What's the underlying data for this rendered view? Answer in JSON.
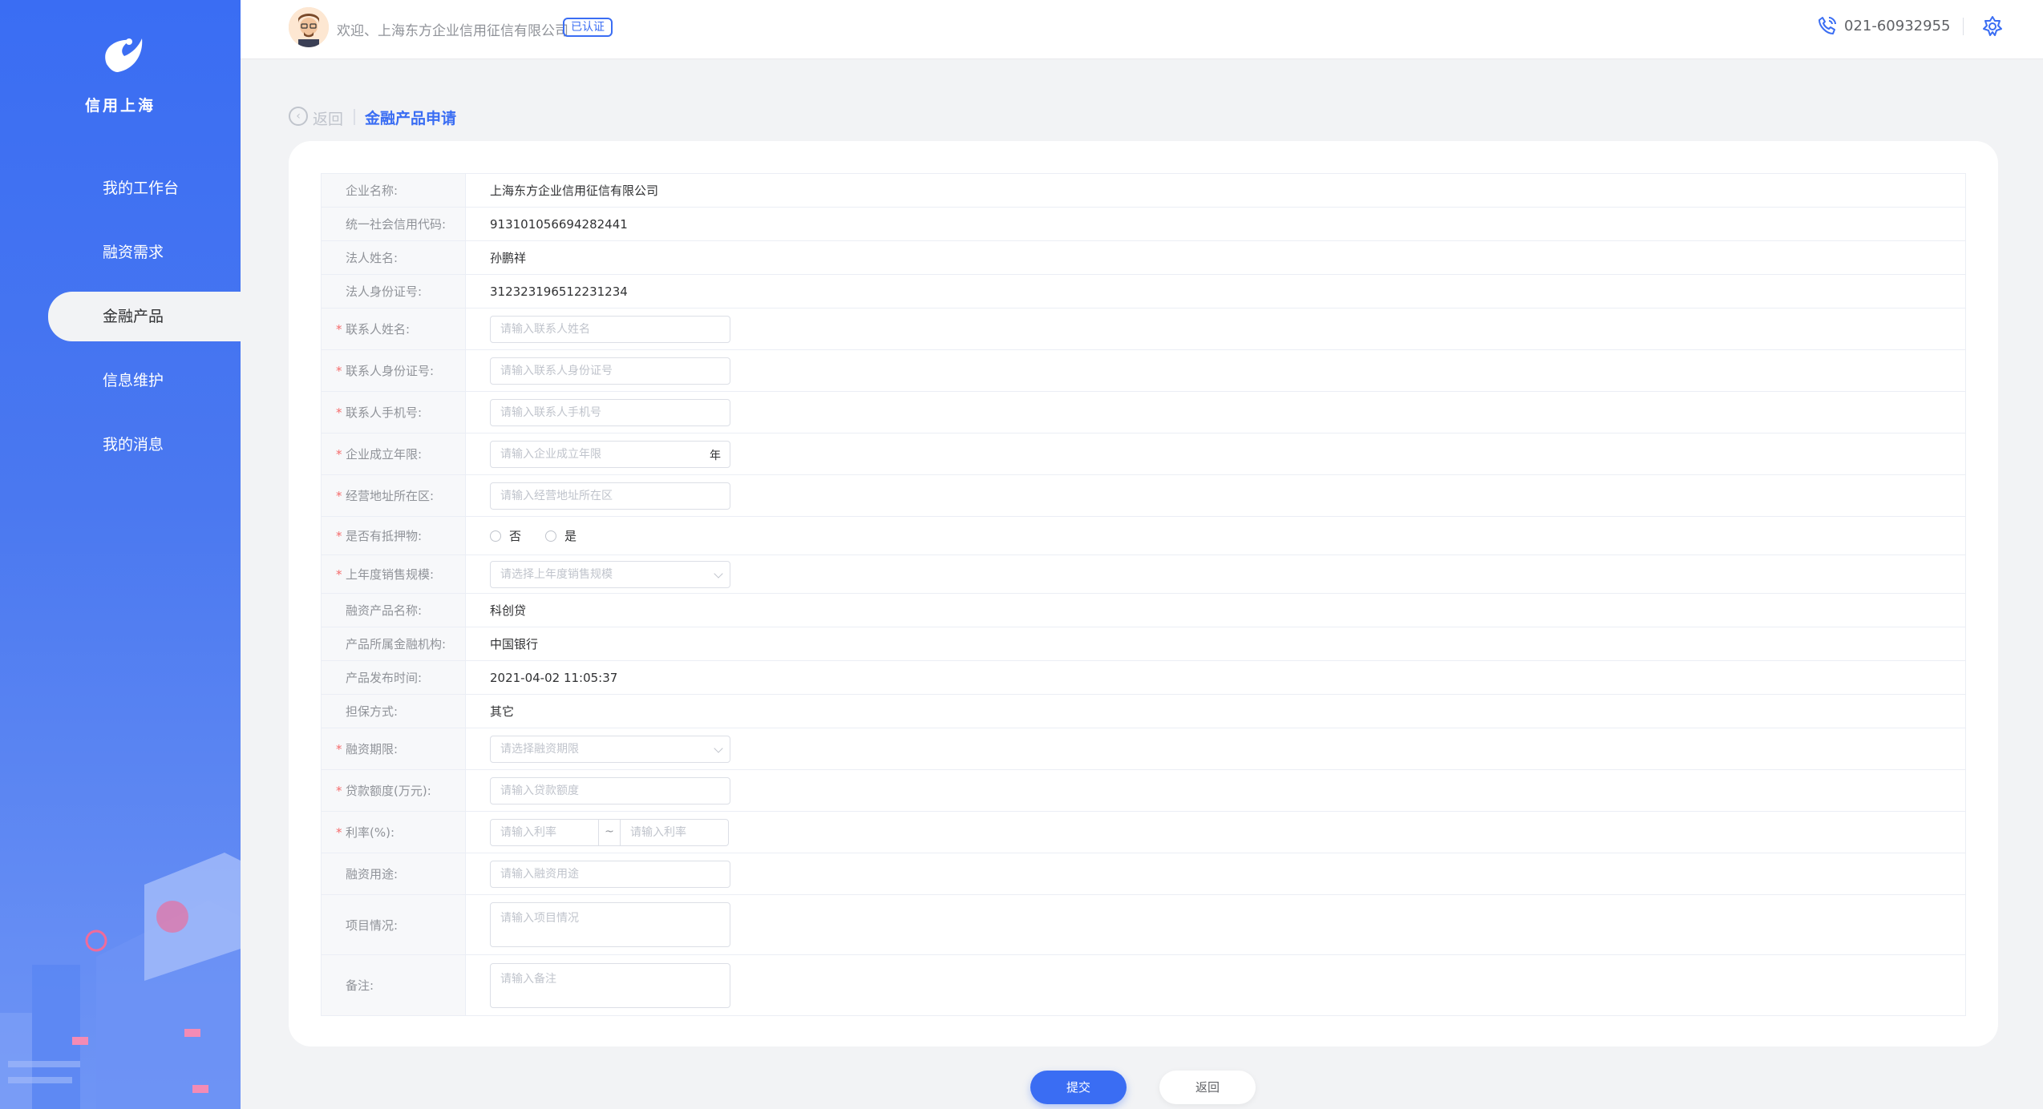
{
  "sidebar": {
    "logo_text": "信用上海",
    "items": [
      {
        "label": "我的工作台"
      },
      {
        "label": "融资需求"
      },
      {
        "label": "金融产品"
      },
      {
        "label": "信息维护"
      },
      {
        "label": "我的消息"
      }
    ]
  },
  "header": {
    "welcome": "欢迎、上海东方企业信用征信有限公司",
    "badge": "已认证",
    "phone": "021-60932955"
  },
  "breadcrumb": {
    "back": "返回",
    "title": "金融产品申请"
  },
  "form": {
    "company_name": {
      "label": "企业名称:",
      "value": "上海东方企业信用征信有限公司"
    },
    "credit_code": {
      "label": "统一社会信用代码:",
      "value": "913101056694282441"
    },
    "legal_name": {
      "label": "法人姓名:",
      "value": "孙鹏祥"
    },
    "legal_id": {
      "label": "法人身份证号:",
      "value": "312323196512231234"
    },
    "contact_name": {
      "label": "联系人姓名:",
      "placeholder": "请输入联系人姓名"
    },
    "contact_id": {
      "label": "联系人身份证号:",
      "placeholder": "请输入联系人身份证号"
    },
    "contact_phone": {
      "label": "联系人手机号:",
      "placeholder": "请输入联系人手机号"
    },
    "company_years": {
      "label": "企业成立年限:",
      "placeholder": "请输入企业成立年限",
      "suffix": "年"
    },
    "address": {
      "label": "经营地址所在区:",
      "placeholder": "请输入经营地址所在区"
    },
    "collateral": {
      "label": "是否有抵押物:",
      "opt_no": "否",
      "opt_yes": "是"
    },
    "sales": {
      "label": "上年度销售规模:",
      "placeholder": "请选择上年度销售规模"
    },
    "product_name": {
      "label": "融资产品名称:",
      "value": "科创贷"
    },
    "institution": {
      "label": "产品所属金融机构:",
      "value": "中国银行"
    },
    "publish_time": {
      "label": "产品发布时间:",
      "value": "2021-04-02 11:05:37"
    },
    "guarantee": {
      "label": "担保方式:",
      "value": "其它"
    },
    "term": {
      "label": "融资期限:",
      "placeholder": "请选择融资期限"
    },
    "amount": {
      "label": "贷款额度(万元):",
      "placeholder": "请输入贷款额度"
    },
    "rate": {
      "label": "利率(%):",
      "placeholder_from": "请输入利率",
      "sep": "~",
      "placeholder_to": "请输入利率"
    },
    "purpose": {
      "label": "融资用途:",
      "placeholder": "请输入融资用途"
    },
    "project": {
      "label": "项目情况:",
      "placeholder": "请输入项目情况"
    },
    "remark": {
      "label": "备注:",
      "placeholder": "请输入备注"
    }
  },
  "buttons": {
    "submit": "提交",
    "back": "返回"
  },
  "colors": {
    "primary": "#3a6df3",
    "required": "#f56c6c"
  }
}
